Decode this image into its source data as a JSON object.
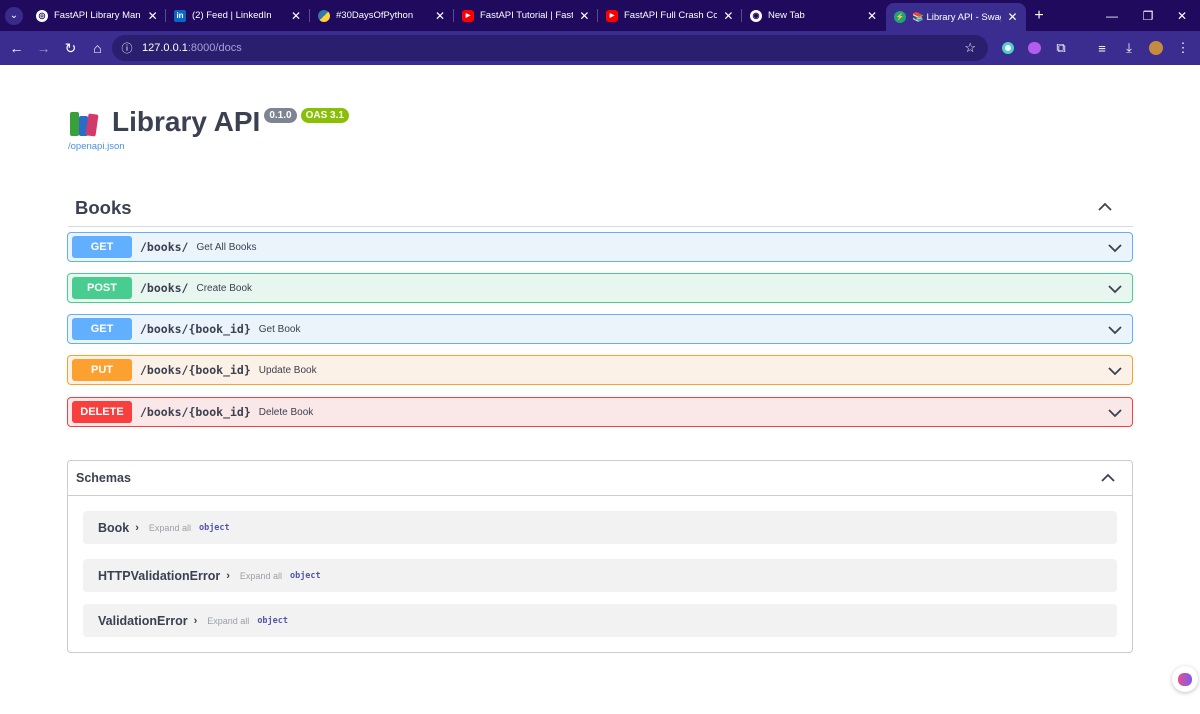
{
  "browser": {
    "tabs": [
      {
        "title": "FastAPI Library Manag",
        "icon": "globe-icon"
      },
      {
        "title": "(2) Feed | LinkedIn",
        "icon": "linkedin-icon"
      },
      {
        "title": "#30DaysOfPython",
        "icon": "python-icon"
      },
      {
        "title": "FastAPI Tutorial | FastA",
        "icon": "youtube-icon"
      },
      {
        "title": "FastAPI Full Crash Cou",
        "icon": "youtube-icon"
      },
      {
        "title": "New Tab",
        "icon": "chrome-icon"
      },
      {
        "title": "📚 Library API - Swagg",
        "icon": "swagger-icon"
      }
    ],
    "address": {
      "host": "127.0.0.1",
      "path": ":8000/docs"
    }
  },
  "api": {
    "title": "Library API",
    "version": "0.1.0",
    "oas": "OAS 3.1",
    "openapi_link": "/openapi.json"
  },
  "tag": {
    "name": "Books"
  },
  "operations": [
    {
      "method": "GET",
      "path": "/books/",
      "summary": "Get All Books"
    },
    {
      "method": "POST",
      "path": "/books/",
      "summary": "Create Book"
    },
    {
      "method": "GET",
      "path": "/books/{book_id}",
      "summary": "Get Book"
    },
    {
      "method": "PUT",
      "path": "/books/{book_id}",
      "summary": "Update Book"
    },
    {
      "method": "DELETE",
      "path": "/books/{book_id}",
      "summary": "Delete Book"
    }
  ],
  "schemas": {
    "title": "Schemas",
    "items": [
      {
        "name": "Book",
        "expand": "Expand all",
        "type": "object"
      },
      {
        "name": "HTTPValidationError",
        "expand": "Expand all",
        "type": "object"
      },
      {
        "name": "ValidationError",
        "expand": "Expand all",
        "type": "object"
      }
    ]
  },
  "colors": {
    "get": "#61affe",
    "post": "#49cc90",
    "put": "#fca130",
    "delete": "#f93e3e",
    "chrome": "#3b2d8f"
  }
}
